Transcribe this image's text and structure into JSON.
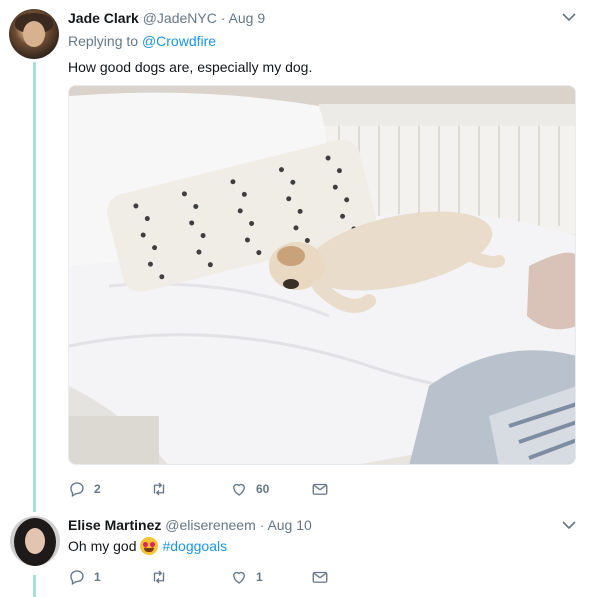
{
  "tweets": [
    {
      "name": "Jade Clark",
      "handle": "@JadeNYC",
      "separator": "·",
      "date": "Aug 9",
      "replying_prefix": "Replying to",
      "replying_to": "@Crowdfire",
      "text": "How good dogs are, especially my dog.",
      "media_icon": "photo-dog-sleeping-on-daybed",
      "actions": {
        "replies": "2",
        "retweets": "",
        "likes": "60"
      }
    },
    {
      "name": "Elise Martinez",
      "handle": "@elisereneem",
      "separator": "·",
      "date": "Aug 10",
      "text": "Oh my god",
      "emoji": "heart-eyes-emoji",
      "hashtag": "#doggoals",
      "actions": {
        "replies": "1",
        "retweets": "",
        "likes": "1"
      }
    }
  ],
  "colors": {
    "thread_line": "#a7dfe0",
    "link": "#1b95e0",
    "muted": "#657786"
  }
}
